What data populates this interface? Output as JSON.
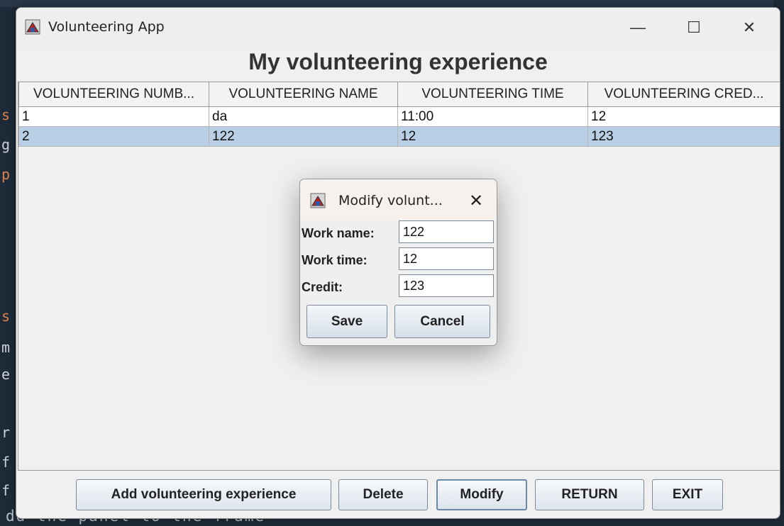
{
  "window": {
    "title": "Volunteering App",
    "minimize_glyph": "—",
    "maximize_glyph": "☐",
    "close_glyph": "✕"
  },
  "heading": "My volunteering experience",
  "table": {
    "columns": [
      "VOLUNTEERING NUMB...",
      "VOLUNTEERING NAME",
      "VOLUNTEERING TIME",
      "VOLUNTEERING CRED..."
    ],
    "rows": [
      [
        "1",
        "da",
        "11:00",
        "12"
      ],
      [
        "2",
        "122",
        "12",
        "123"
      ]
    ],
    "selected_row": 2
  },
  "buttons": {
    "add": "Add volunteering experience",
    "delete": "Delete",
    "modify": "Modify",
    "return": "RETURN",
    "exit": "EXIT"
  },
  "dialog": {
    "title": "Modify volunt...",
    "close_glyph": "✕",
    "work_name_label": "Work name:",
    "work_name_value": "122",
    "work_time_label": "Work time:",
    "work_time_value": "12",
    "credit_label": "Credit:",
    "credit_value": "123",
    "save": "Save",
    "cancel": "Cancel"
  },
  "background": {
    "left_fragments": [
      "s",
      "g",
      "p",
      "s",
      "m",
      "e",
      "r",
      "f",
      "f"
    ],
    "bottom_text": "dd the panel to the frame"
  },
  "colors": {
    "selected_row": "#b8cfe5",
    "window_bg": "#f0f0f0",
    "desktop_bg": "#1e2a38"
  }
}
